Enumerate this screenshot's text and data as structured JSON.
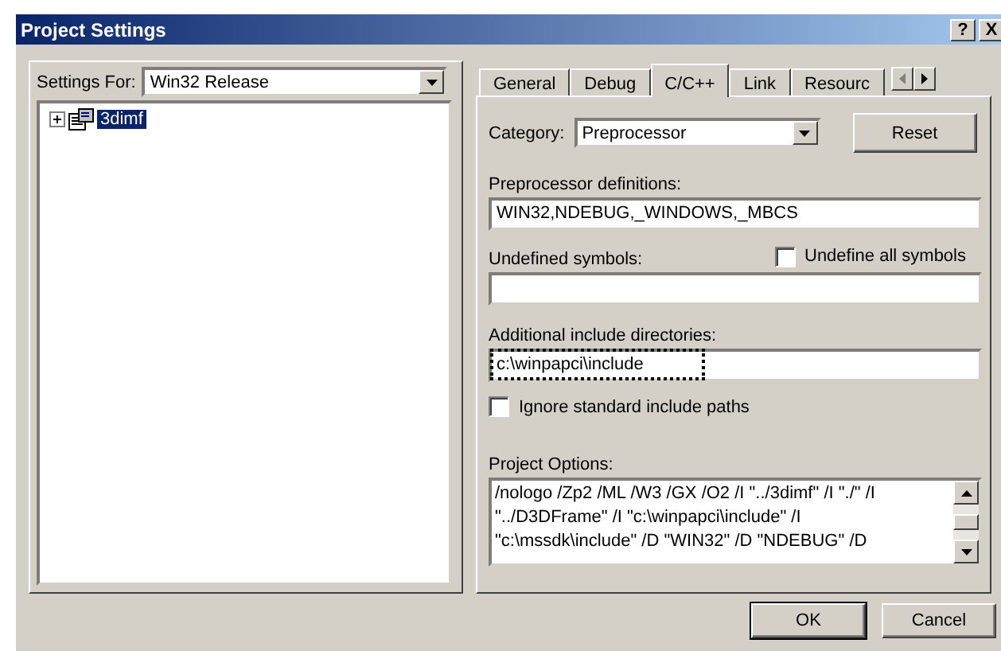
{
  "window": {
    "title": "Project Settings",
    "help_button": "?",
    "close_button": "X"
  },
  "settings_for": {
    "label": "Settings For:",
    "value": "Win32 Release"
  },
  "tree": [
    {
      "label": "3dimf",
      "expanded": false,
      "selected": true
    }
  ],
  "tabs": [
    {
      "label": "General",
      "selected": false
    },
    {
      "label": "Debug",
      "selected": false
    },
    {
      "label": "C/C++",
      "selected": true
    },
    {
      "label": "Link",
      "selected": false
    },
    {
      "label": "Resourc",
      "selected": false
    }
  ],
  "category": {
    "label": "Category:",
    "value": "Preprocessor"
  },
  "reset_button": "Reset",
  "preprocessor_definitions": {
    "label": "Preprocessor definitions:",
    "value": "WIN32,NDEBUG,_WINDOWS,_MBCS"
  },
  "undefined_symbols": {
    "label": "Undefined symbols:"
  },
  "undefine_all": {
    "label": "Undefine all symbols",
    "checked": false
  },
  "include_dirs": {
    "label": "Additional include directories:",
    "value": "c:\\winpapci\\include",
    "focused": true
  },
  "ignore_standard": {
    "label": "Ignore standard include paths",
    "checked": false
  },
  "project_options": {
    "label": "Project Options:",
    "lines": [
      "/nologo /Zp2 /ML /W3 /GX /O2 /I \"../3dimf\" /I \"./\" /I",
      "\"../D3DFrame\" /I \"c:\\winpapci\\include\" /I",
      "\"c:\\mssdk\\include\" /D \"WIN32\" /D \"NDEBUG\" /D"
    ]
  },
  "buttons": [
    {
      "label": "OK",
      "kind": "default"
    },
    {
      "label": "Cancel",
      "kind": "normal"
    }
  ]
}
